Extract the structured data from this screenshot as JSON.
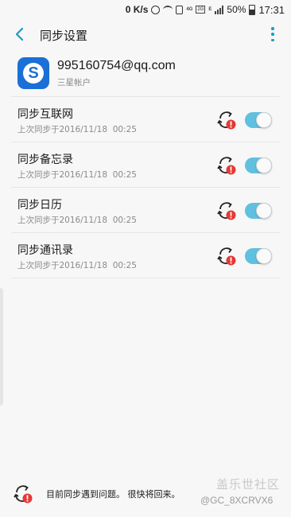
{
  "status_bar": {
    "speed": "0 K/s",
    "network_label": "4G",
    "sim_label": "2G",
    "roaming_label": "E",
    "battery": "50%",
    "time": "17:31"
  },
  "header": {
    "title": "同步设置"
  },
  "account": {
    "email": "995160754@qq.com",
    "type": "三星帐户",
    "logo_letter": "S"
  },
  "sync_items": [
    {
      "title": "同步互联网",
      "last_sync": "上次同步于2016/11/18  00:25",
      "enabled": true
    },
    {
      "title": "同步备忘录",
      "last_sync": "上次同步于2016/11/18  00:25",
      "enabled": true
    },
    {
      "title": "同步日历",
      "last_sync": "上次同步于2016/11/18  00:25",
      "enabled": true
    },
    {
      "title": "同步通讯录",
      "last_sync": "上次同步于2016/11/18  00:25",
      "enabled": true
    }
  ],
  "footer": {
    "message": "目前同步遇到问题。 很快将回来。"
  },
  "watermark": {
    "line1": "盖乐世社区",
    "line2": "@GC_8XCRVX6"
  },
  "colors": {
    "accent": "#1a9bc4",
    "toggle_on": "#5fc0e0",
    "error_red": "#e53935",
    "logo_blue": "#1a70d6"
  }
}
